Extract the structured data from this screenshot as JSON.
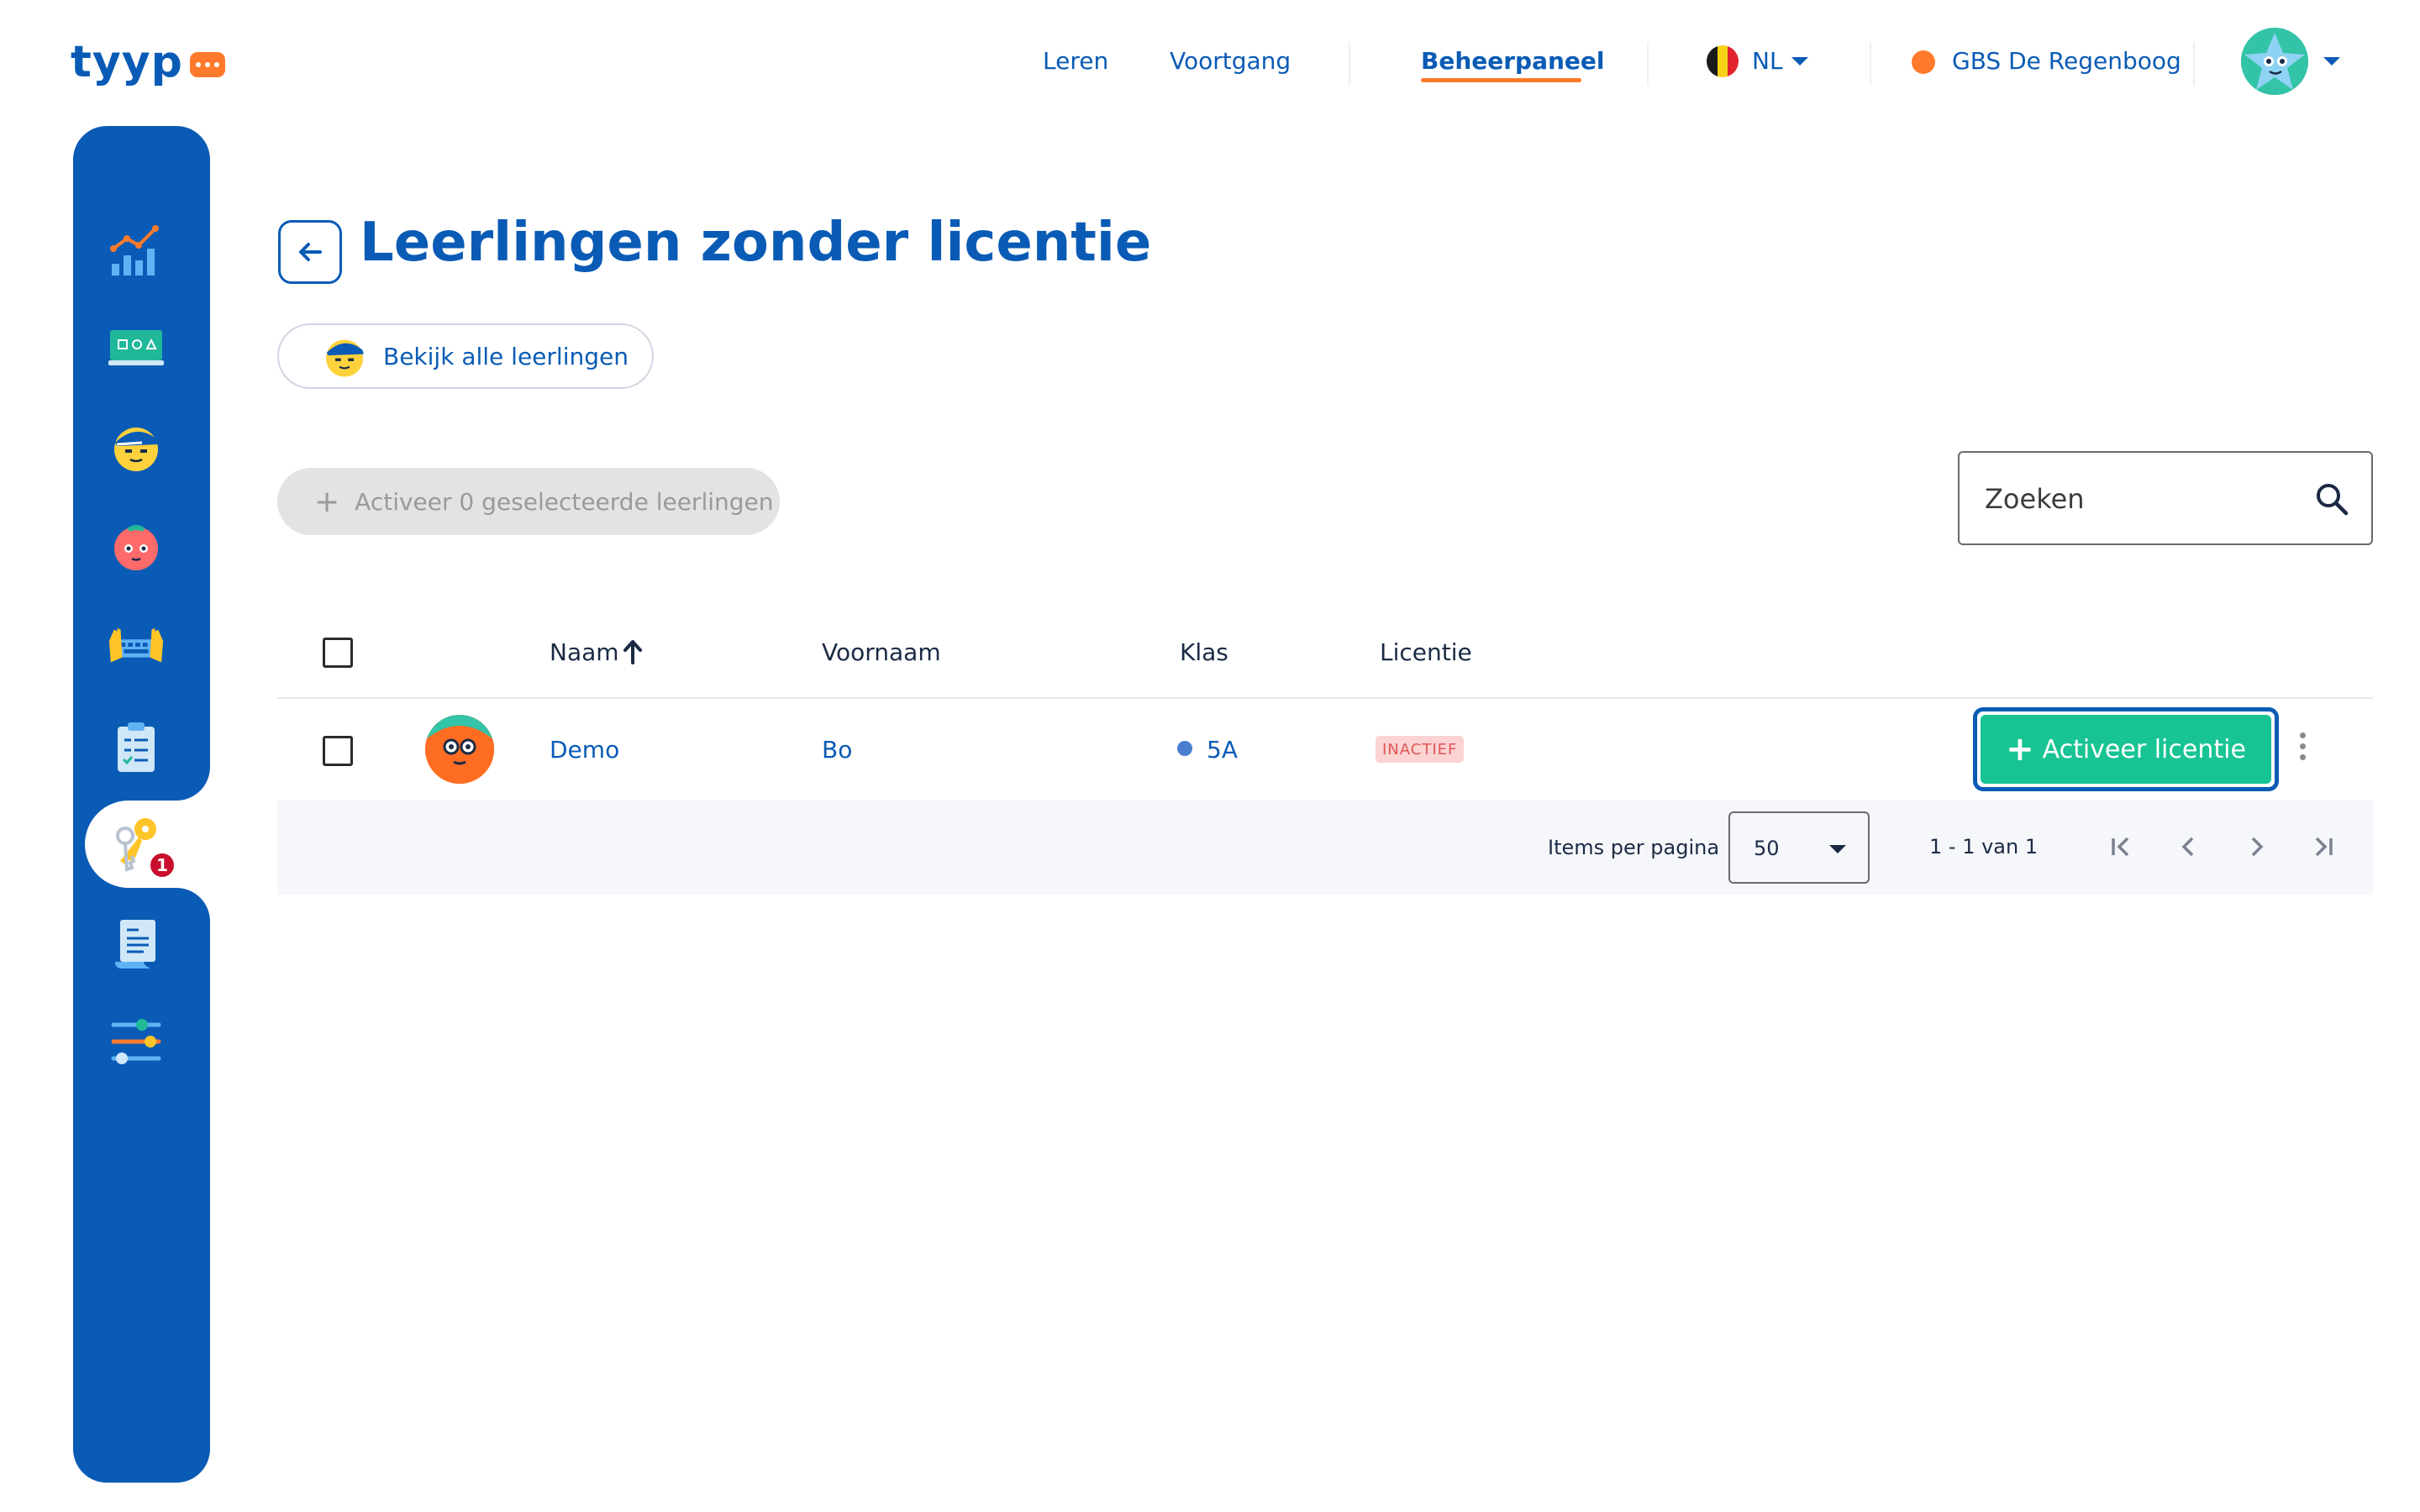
{
  "app": {
    "logo": "tyyp"
  },
  "nav": {
    "links": [
      {
        "label": "Leren"
      },
      {
        "label": "Voortgang"
      },
      {
        "label": "Beheerpaneel",
        "active": true
      }
    ],
    "language": "NL",
    "school": "GBS De Regenboog"
  },
  "sidebar": {
    "items": [
      {
        "icon": "statistics-chart-icon"
      },
      {
        "icon": "classroom-board-icon"
      },
      {
        "icon": "student-face-icon"
      },
      {
        "icon": "teacher-face-icon"
      },
      {
        "icon": "hands-keyboard-icon"
      },
      {
        "icon": "checklist-clipboard-icon"
      },
      {
        "icon": "keys-icon",
        "active": true,
        "badge": "1"
      },
      {
        "icon": "document-receipt-icon"
      },
      {
        "icon": "settings-sliders-icon"
      }
    ]
  },
  "page": {
    "title": "Leerlingen zonder licentie",
    "view_all_label": "Bekijk alle leerlingen",
    "activate_selected_label": "Activeer 0 geselecteerde leerlingen",
    "search_placeholder": "Zoeken"
  },
  "table": {
    "headers": {
      "naam": "Naam",
      "voornaam": "Voornaam",
      "klas": "Klas",
      "licentie": "Licentie"
    },
    "rows": [
      {
        "naam": "Demo",
        "voornaam": "Bo",
        "klas": "5A",
        "licentie": "INACTIEF",
        "action": "Activeer licentie"
      }
    ]
  },
  "paginator": {
    "items_per_page_label": "Items per pagina",
    "page_size": "50",
    "range": "1 - 1 van 1"
  },
  "colors": {
    "brand_blue": "#0a5bb5",
    "accent_orange": "#ff7a2b",
    "activate_green": "#18c493",
    "inactive_red": "#e05656"
  }
}
